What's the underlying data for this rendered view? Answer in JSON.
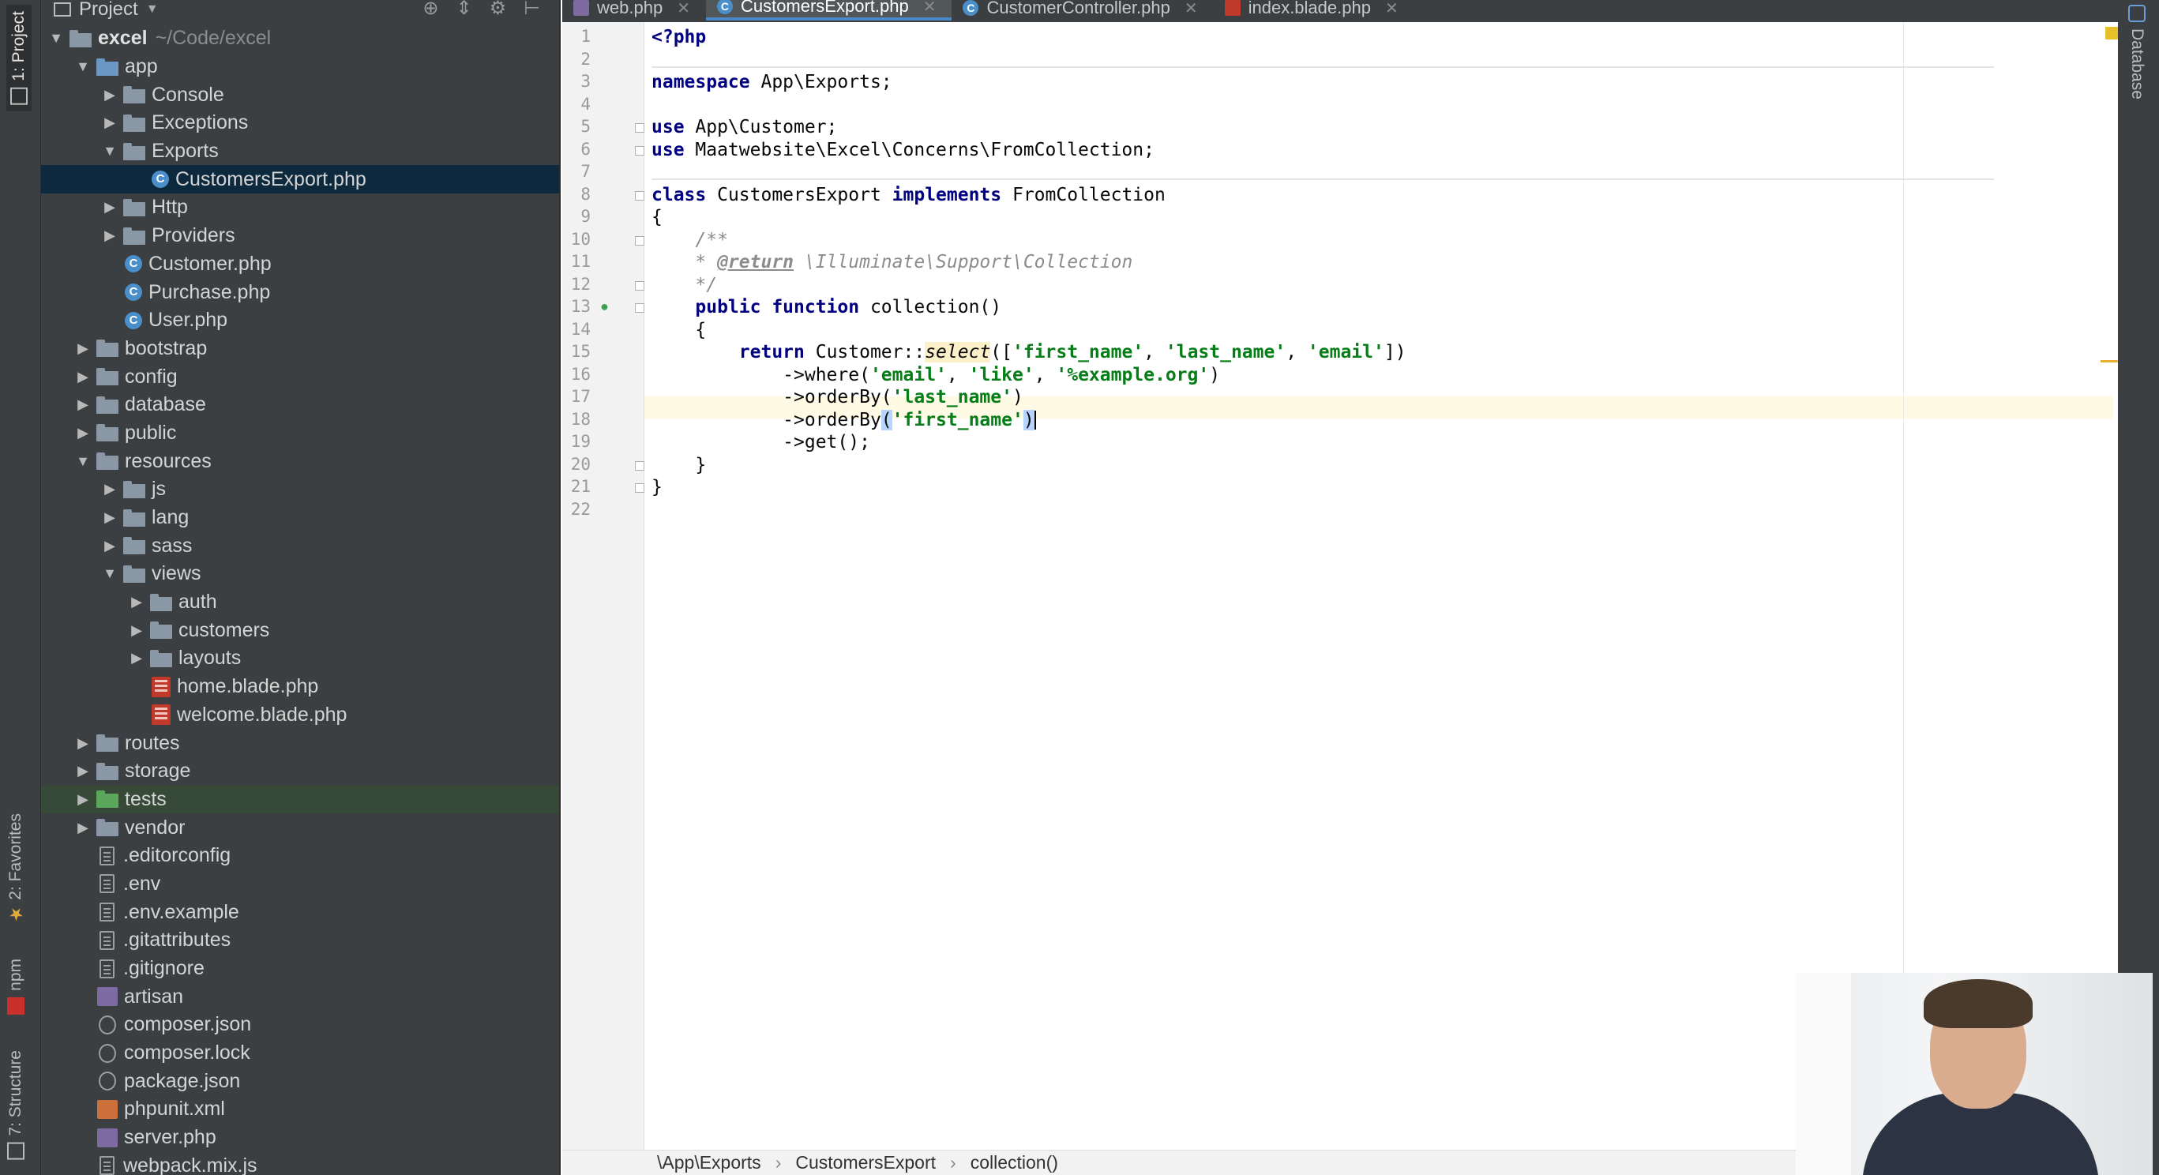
{
  "left_strip": {
    "project_tab": "1: Project",
    "favorites_tab": "2: Favorites",
    "npm_tab": "npm",
    "structure_tab": "7: Structure"
  },
  "right_strip": {
    "database_tab": "Database"
  },
  "project_panel": {
    "title": "Project",
    "tree": [
      {
        "label": "excel",
        "hint": "~/Code/excel",
        "level": 0,
        "expand": "open",
        "icon": "folder",
        "bold": true
      },
      {
        "label": "app",
        "level": 1,
        "expand": "open",
        "icon": "folder-blue"
      },
      {
        "label": "Console",
        "level": 2,
        "expand": "closed",
        "icon": "folder"
      },
      {
        "label": "Exceptions",
        "level": 2,
        "expand": "closed",
        "icon": "folder"
      },
      {
        "label": "Exports",
        "level": 2,
        "expand": "open",
        "icon": "folder"
      },
      {
        "label": "CustomersExport.php",
        "level": 3,
        "expand": "none",
        "icon": "class",
        "selected": true
      },
      {
        "label": "Http",
        "level": 2,
        "expand": "closed",
        "icon": "folder"
      },
      {
        "label": "Providers",
        "level": 2,
        "expand": "closed",
        "icon": "folder"
      },
      {
        "label": "Customer.php",
        "level": 2,
        "expand": "none",
        "icon": "class"
      },
      {
        "label": "Purchase.php",
        "level": 2,
        "expand": "none",
        "icon": "class"
      },
      {
        "label": "User.php",
        "level": 2,
        "expand": "none",
        "icon": "class"
      },
      {
        "label": "bootstrap",
        "level": 1,
        "expand": "closed",
        "icon": "folder"
      },
      {
        "label": "config",
        "level": 1,
        "expand": "closed",
        "icon": "folder"
      },
      {
        "label": "database",
        "level": 1,
        "expand": "closed",
        "icon": "folder"
      },
      {
        "label": "public",
        "level": 1,
        "expand": "closed",
        "icon": "folder"
      },
      {
        "label": "resources",
        "level": 1,
        "expand": "open",
        "icon": "folder"
      },
      {
        "label": "js",
        "level": 2,
        "expand": "closed",
        "icon": "folder"
      },
      {
        "label": "lang",
        "level": 2,
        "expand": "closed",
        "icon": "folder"
      },
      {
        "label": "sass",
        "level": 2,
        "expand": "closed",
        "icon": "folder"
      },
      {
        "label": "views",
        "level": 2,
        "expand": "open",
        "icon": "folder"
      },
      {
        "label": "auth",
        "level": 3,
        "expand": "closed",
        "icon": "folder"
      },
      {
        "label": "customers",
        "level": 3,
        "expand": "closed",
        "icon": "folder"
      },
      {
        "label": "layouts",
        "level": 3,
        "expand": "closed",
        "icon": "folder"
      },
      {
        "label": "home.blade.php",
        "level": 3,
        "expand": "none",
        "icon": "blade"
      },
      {
        "label": "welcome.blade.php",
        "level": 3,
        "expand": "none",
        "icon": "blade"
      },
      {
        "label": "routes",
        "level": 1,
        "expand": "closed",
        "icon": "folder"
      },
      {
        "label": "storage",
        "level": 1,
        "expand": "closed",
        "icon": "folder"
      },
      {
        "label": "tests",
        "level": 1,
        "expand": "closed",
        "icon": "folder-green",
        "highlight": true
      },
      {
        "label": "vendor",
        "level": 1,
        "expand": "closed",
        "icon": "folder"
      },
      {
        "label": ".editorconfig",
        "level": 1,
        "expand": "none",
        "icon": "file"
      },
      {
        "label": ".env",
        "level": 1,
        "expand": "none",
        "icon": "file"
      },
      {
        "label": ".env.example",
        "level": 1,
        "expand": "none",
        "icon": "file"
      },
      {
        "label": ".gitattributes",
        "level": 1,
        "expand": "none",
        "icon": "file"
      },
      {
        "label": ".gitignore",
        "level": 1,
        "expand": "none",
        "icon": "file"
      },
      {
        "label": "artisan",
        "level": 1,
        "expand": "none",
        "icon": "php"
      },
      {
        "label": "composer.json",
        "level": 1,
        "expand": "none",
        "icon": "json"
      },
      {
        "label": "composer.lock",
        "level": 1,
        "expand": "none",
        "icon": "json"
      },
      {
        "label": "package.json",
        "level": 1,
        "expand": "none",
        "icon": "json"
      },
      {
        "label": "phpunit.xml",
        "level": 1,
        "expand": "none",
        "icon": "xml"
      },
      {
        "label": "server.php",
        "level": 1,
        "expand": "none",
        "icon": "php"
      },
      {
        "label": "webpack.mix.js",
        "level": 1,
        "expand": "none",
        "icon": "file"
      }
    ]
  },
  "tabs": [
    {
      "label": "web.php",
      "icon": "php",
      "active": false
    },
    {
      "label": "CustomersExport.php",
      "icon": "class",
      "active": true
    },
    {
      "label": "CustomerController.php",
      "icon": "class",
      "active": false
    },
    {
      "label": "index.blade.php",
      "icon": "blade",
      "active": false
    }
  ],
  "code_lines": [
    [
      [
        "ph",
        "<?php"
      ]
    ],
    [],
    [
      [
        "kw",
        "namespace"
      ],
      [
        "t",
        " App\\Exports;"
      ]
    ],
    [],
    [
      [
        "kw",
        "use"
      ],
      [
        "t",
        " App\\Customer;"
      ]
    ],
    [
      [
        "kw",
        "use"
      ],
      [
        "t",
        " Maatwebsite\\Excel\\Concerns\\FromCollection;"
      ]
    ],
    [],
    [
      [
        "kw",
        "class"
      ],
      [
        "t",
        " CustomersExport "
      ],
      [
        "kw",
        "implements"
      ],
      [
        "t",
        " FromCollection"
      ]
    ],
    [
      [
        "t",
        "{"
      ]
    ],
    [
      [
        "cmt",
        "    /**"
      ]
    ],
    [
      [
        "cmt",
        "    * "
      ],
      [
        "tag",
        "@return"
      ],
      [
        "cmt",
        " \\Illuminate\\Support\\Collection"
      ]
    ],
    [
      [
        "cmt",
        "    */"
      ]
    ],
    [
      [
        "kw",
        "    public function"
      ],
      [
        "t",
        " collection()"
      ]
    ],
    [
      [
        "t",
        "    {"
      ]
    ],
    [
      [
        "kw",
        "        return"
      ],
      [
        "t",
        " Customer::"
      ],
      [
        "selit",
        "select"
      ],
      [
        "t",
        "(["
      ],
      [
        "str",
        "'first_name'"
      ],
      [
        "t",
        ", "
      ],
      [
        "str",
        "'last_name'"
      ],
      [
        "t",
        ", "
      ],
      [
        "str",
        "'email'"
      ],
      [
        "t",
        "])"
      ]
    ],
    [
      [
        "t",
        "            ->where("
      ],
      [
        "str",
        "'email'"
      ],
      [
        "t",
        ", "
      ],
      [
        "str",
        "'like'"
      ],
      [
        "t",
        ", "
      ],
      [
        "str",
        "'%example.org'"
      ],
      [
        "t",
        ")"
      ]
    ],
    [
      [
        "t",
        "            ->orderBy("
      ],
      [
        "str",
        "'last_name'"
      ],
      [
        "t",
        ")"
      ]
    ],
    [
      [
        "t",
        "            ->orderBy"
      ],
      [
        "paren",
        "("
      ],
      [
        "str",
        "'first_name'"
      ],
      [
        "paren",
        ")"
      ]
    ],
    [
      [
        "t",
        "            ->get();"
      ]
    ],
    [
      [
        "t",
        "    }"
      ]
    ],
    [
      [
        "t",
        "}"
      ]
    ],
    []
  ],
  "breadcrumb": [
    "\\App\\Exports",
    "CustomersExport",
    "collection()"
  ]
}
